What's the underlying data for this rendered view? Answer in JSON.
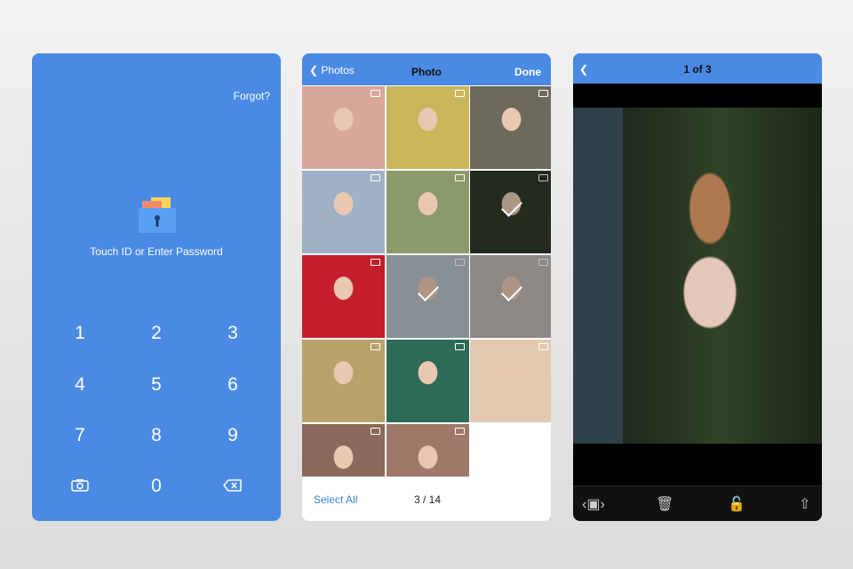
{
  "lock_screen": {
    "forgot": "Forgot?",
    "prompt": "Touch ID or Enter Password",
    "keys": [
      "1",
      "2",
      "3",
      "4",
      "5",
      "6",
      "7",
      "8",
      "9",
      "0"
    ],
    "camera_icon": "camera-icon",
    "delete_icon": "backspace-icon"
  },
  "album": {
    "back_label": "Photos",
    "title": "Photo",
    "done": "Done",
    "select_all": "Select All",
    "count": "3 / 14",
    "photos": [
      {
        "color": "#d9a79a",
        "selected": false
      },
      {
        "color": "#c9b65a",
        "selected": false
      },
      {
        "color": "#6c6a5c",
        "selected": false
      },
      {
        "color": "#9fb1c4",
        "selected": false
      },
      {
        "color": "#8a9a6a",
        "selected": false
      },
      {
        "color": "#2f3a2a",
        "selected": true
      },
      {
        "color": "#c41e2a",
        "selected": false
      },
      {
        "color": "#b6c0c8",
        "selected": true
      },
      {
        "color": "#bdb6b0",
        "selected": true
      },
      {
        "color": "#b7a36a",
        "selected": false
      },
      {
        "color": "#2e6a58",
        "selected": false
      },
      {
        "color": "#e2c9b0",
        "selected": false
      },
      {
        "color": "#8a6a5a",
        "selected": false
      },
      {
        "color": "#a0786a",
        "selected": false
      }
    ]
  },
  "viewer": {
    "title": "1 of 3",
    "tools": [
      "slideshow-icon",
      "trash-icon",
      "unlock-icon",
      "share-icon"
    ]
  },
  "accent": "#4a8ae4"
}
